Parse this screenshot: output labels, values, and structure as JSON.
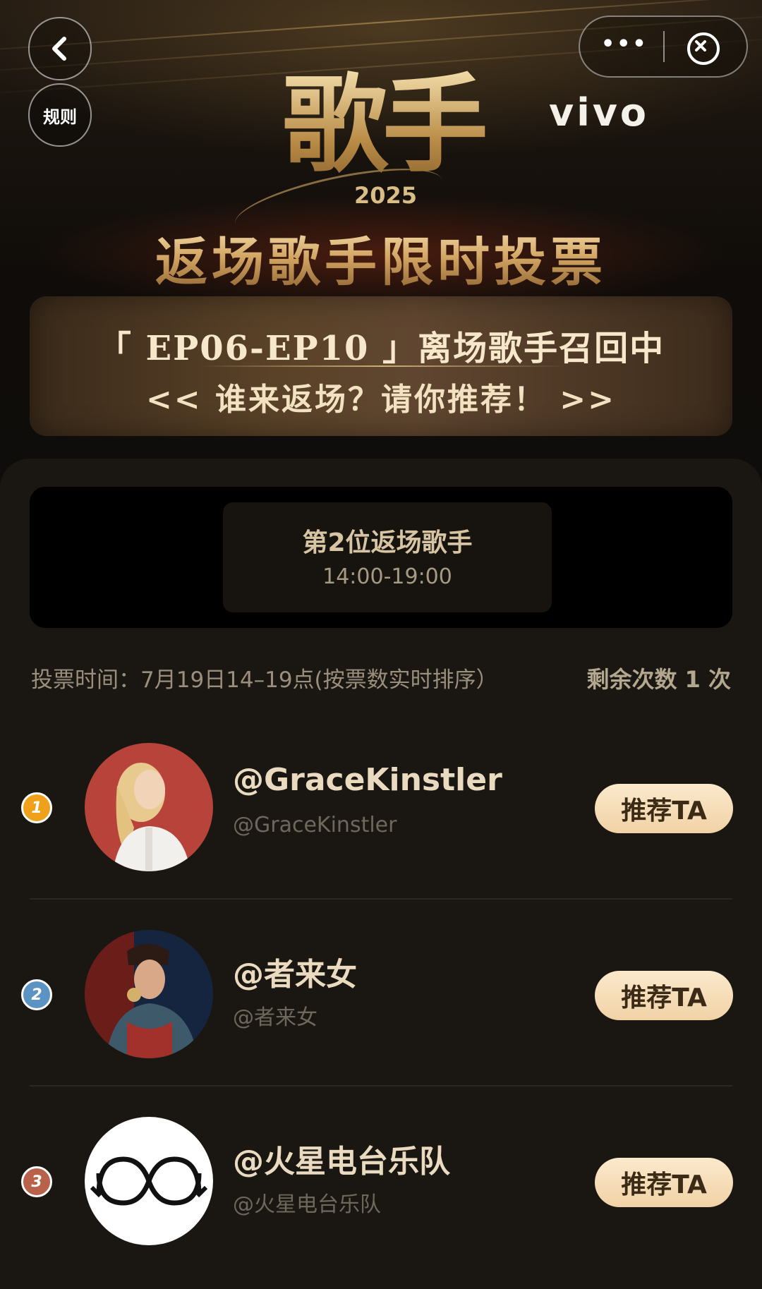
{
  "header": {
    "rules_label": "规则",
    "menu_dots": "•••",
    "sponsor": "vivo",
    "logo_text": "歌手",
    "logo_year": "2025",
    "headline": "返场歌手限时投票",
    "banner_line1": "「 EP06-EP10 」离场歌手召回中",
    "banner_line2": "<< 谁来返场？请你推荐！ >>"
  },
  "slot": {
    "title": "第2位返场歌手",
    "time": "14:00-19:00"
  },
  "info": {
    "vote_time": "投票时间：7月19日14–19点(按票数实时排序）",
    "remaining": "剩余次数 1 次"
  },
  "candidates": [
    {
      "rank": "1",
      "name": "@GraceKinstler",
      "handle": "@GraceKinstler",
      "button": "推荐TA",
      "rank_color": "#f0a11c"
    },
    {
      "rank": "2",
      "name": "@者来女",
      "handle": "@者来女",
      "button": "推荐TA",
      "rank_color": "#5b93c2"
    },
    {
      "rank": "3",
      "name": "@火星电台乐队",
      "handle": "@火星电台乐队",
      "button": "推荐TA",
      "rank_color": "#b8614b"
    }
  ],
  "colors": {
    "accent_gold": "#c9a46a",
    "button_bg": "#f4d9b0",
    "panel_bg": "#1a1712"
  }
}
